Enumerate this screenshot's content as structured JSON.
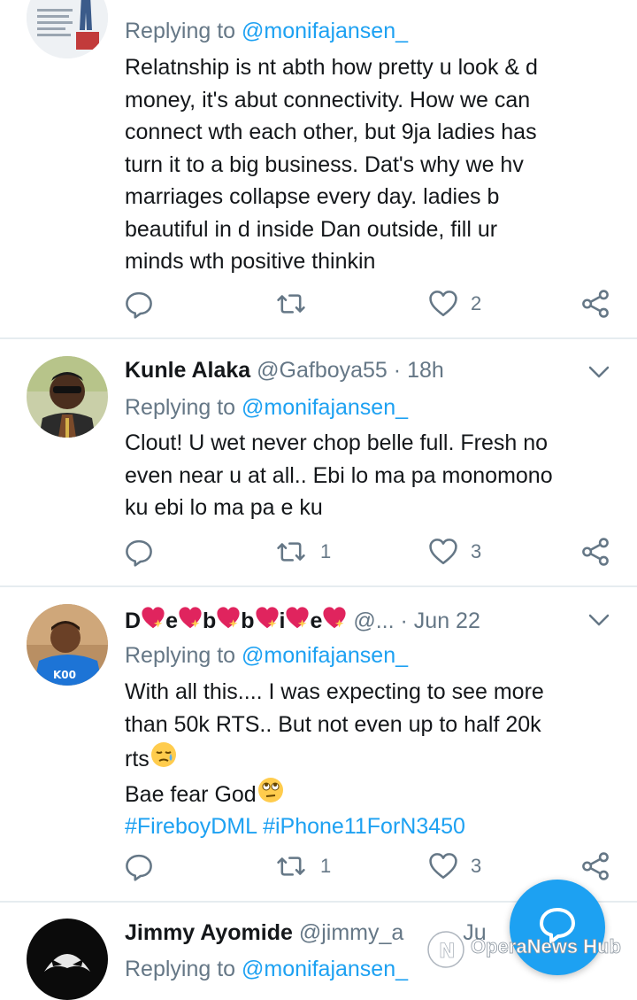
{
  "tweets": [
    {
      "reply_prefix": "Replying to",
      "mention": "@monifajansen_",
      "lines": [
        "Relatnship is nt abth how pretty u look & d",
        "money, it's abut connectivity. How we can",
        "connect wth each other, but 9ja ladies has",
        "turn it to a big business. Dat's why we hv",
        "marriages collapse every day. ladies b",
        "beautiful in d inside Dan outside, fill ur",
        "minds wth positive thinkin"
      ],
      "retweets": "",
      "likes": "2"
    },
    {
      "name": "Kunle Alaka",
      "handle": "@Gafboya55",
      "sep": "·",
      "time": "18h",
      "reply_prefix": "Replying to",
      "mention": "@monifajansen_",
      "lines": [
        "Clout! U wet never chop belle full. Fresh no",
        "even near u at all.. Ebi lo ma pa monomono",
        "ku ebi lo ma pa e ku"
      ],
      "retweets": "1",
      "likes": "3"
    },
    {
      "name_letters": [
        "D",
        "e",
        "b",
        "b",
        "i",
        "e"
      ],
      "handle": "@...",
      "sep": "·",
      "time": "Jun 22",
      "reply_prefix": "Replying to",
      "mention": "@monifajansen_",
      "line1": "With all this.... I was expecting to see more",
      "line2": "than 50k RTS.. But not even up to half 20k",
      "line3": "rts",
      "line4": "Bae fear God",
      "hashtag1": "#FireboyDML",
      "hashtag2": "#iPhone11ForN3450",
      "retweets": "1",
      "likes": "3"
    },
    {
      "name": "Jimmy Ayomide",
      "handle": "@jimmy_a",
      "time": "Ju",
      "reply_prefix": "Replying to",
      "mention": "@monifajansen_"
    }
  ],
  "watermark": "OperaNews Hub",
  "icons": [
    "reply-icon",
    "retweet-icon",
    "like-icon",
    "share-icon",
    "chevron-down-icon",
    "compose-icon"
  ],
  "colors": {
    "accent": "#1da1f2",
    "muted": "#657786",
    "text": "#14171a",
    "divider": "#e6ecf0",
    "heart": "#e0245e"
  }
}
